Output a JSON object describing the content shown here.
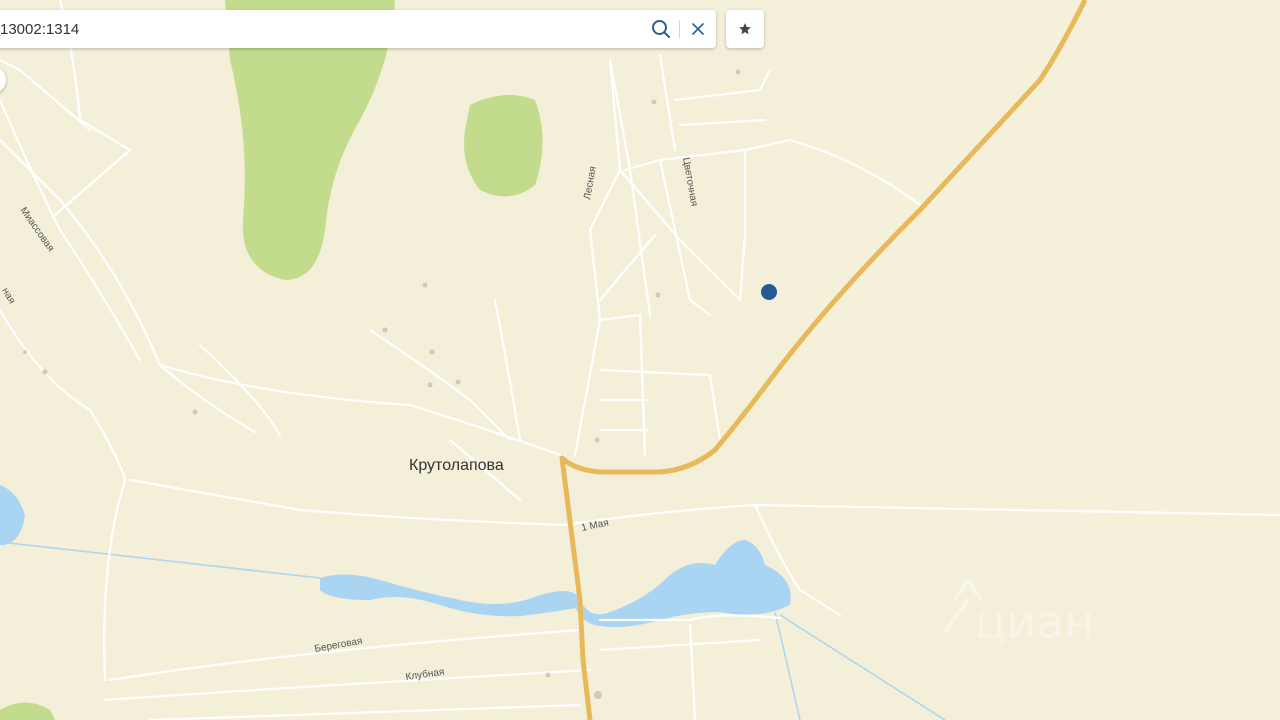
{
  "search": {
    "value": "13002:1314"
  },
  "icons": {
    "search": "search-icon",
    "clear": "close-icon",
    "favorite": "star-icon"
  },
  "map": {
    "settlement": "Крутолапова",
    "streets": [
      "Лесная",
      "Цветочная",
      "Миассовая",
      "ная",
      "1 Мая",
      "Береговая",
      "Клубная"
    ],
    "watermark": "циан"
  },
  "colors": {
    "land": "#f3efd9",
    "road": "#e8b95a",
    "water": "#a9d5f2",
    "forest": "#c3db8c",
    "marker": "#255a96"
  }
}
